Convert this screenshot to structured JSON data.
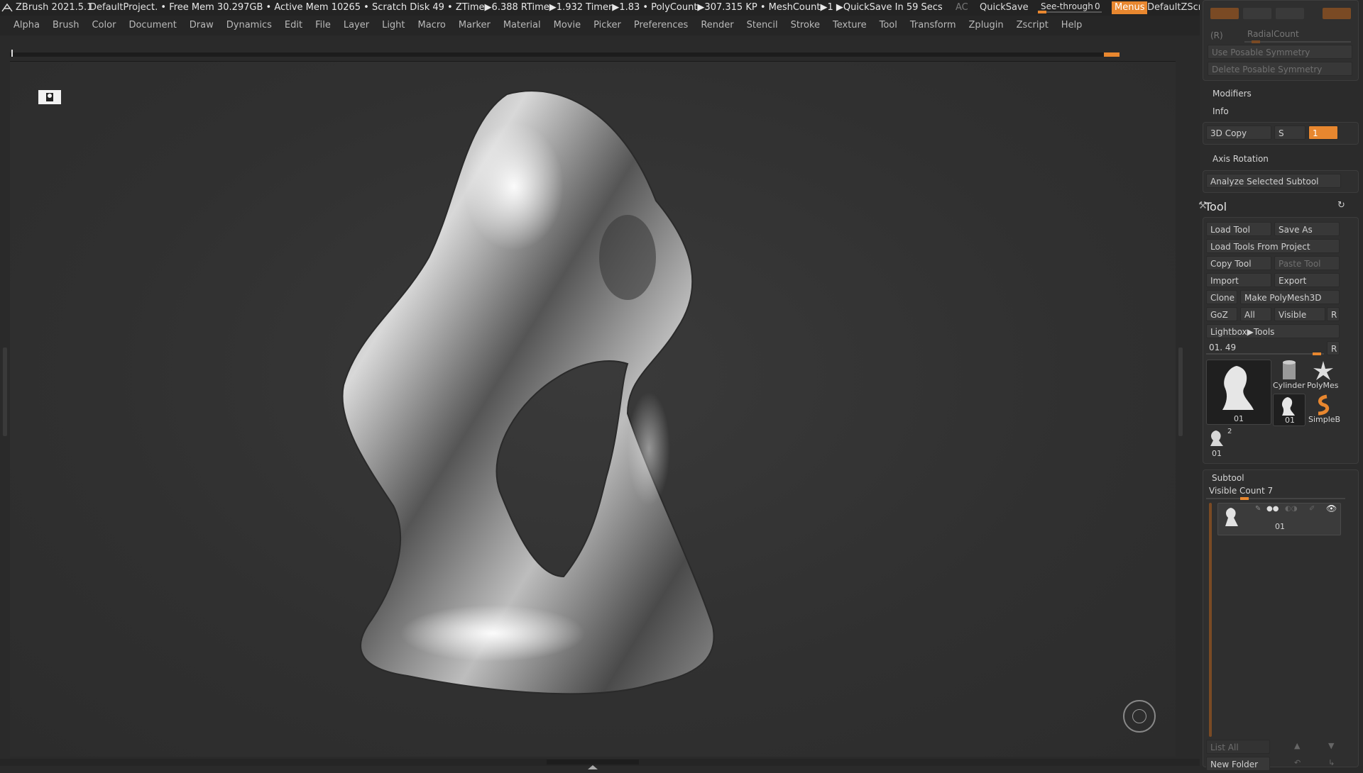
{
  "titlebar": {
    "app": "ZBrush 2021.5.1",
    "project": "DefaultProject",
    "stats": ".. • Free Mem 30.297GB • Active Mem 10265 • Scratch Disk 49 •  ZTime▶6.388 RTime▶1.932 Timer▶1.83 • PolyCount▶307.315 KP  • MeshCount▶1  ▶QuickSave In 59 Secs",
    "ac": "AC",
    "quicksave": "QuickSave",
    "seethrough": "See-through",
    "seethrough_value": "0",
    "menus": "Menus",
    "script": "DefaultZScript"
  },
  "menubar": [
    "Alpha",
    "Brush",
    "Color",
    "Document",
    "Draw",
    "Dynamics",
    "Edit",
    "File",
    "Layer",
    "Light",
    "Macro",
    "Marker",
    "Material",
    "Movie",
    "Picker",
    "Preferences",
    "Render",
    "Stencil",
    "Stroke",
    "Texture",
    "Tool",
    "Transform",
    "Zplugin",
    "Zscript",
    "Help"
  ],
  "tray_top": {
    "r_label": "(R)",
    "radialcount": "RadialCount",
    "use_posable": "Use Posable Symmetry",
    "delete_posable": "Delete Posable Symmetry",
    "modifiers": "Modifiers",
    "info": "Info",
    "copy3d": "3D Copy",
    "copy3d_s": "S",
    "copy3d_value": "1",
    "axis_rotation": "Axis Rotation",
    "analyze": "Analyze Selected Subtool"
  },
  "tool": {
    "title": "Tool",
    "load_tool": "Load Tool",
    "save_as": "Save As",
    "load_from_project": "Load Tools From Project",
    "copy_tool": "Copy Tool",
    "paste_tool": "Paste Tool",
    "import": "Import",
    "export": "Export",
    "clone": "Clone",
    "make_polymesh": "Make PolyMesh3D",
    "goz": "GoZ",
    "all": "All",
    "visible": "Visible",
    "r": "R",
    "lightbox": "Lightbox▶Tools",
    "slider_label": "01. 49",
    "thumbs": {
      "main": "01",
      "cylinder": "Cylinder",
      "polymesh": "PolyMes",
      "small01": "01",
      "simpleb": "SimpleB",
      "tiny01": "01",
      "tiny_badge": "2"
    }
  },
  "subtool": {
    "title": "Subtool",
    "visible_count": "Visible Count 7",
    "item_label": "01",
    "list_all": "List All",
    "new_folder": "New Folder"
  },
  "colors": {
    "accent": "#e8872f",
    "bg": "#2a2a2a",
    "viewport": "#313131"
  }
}
